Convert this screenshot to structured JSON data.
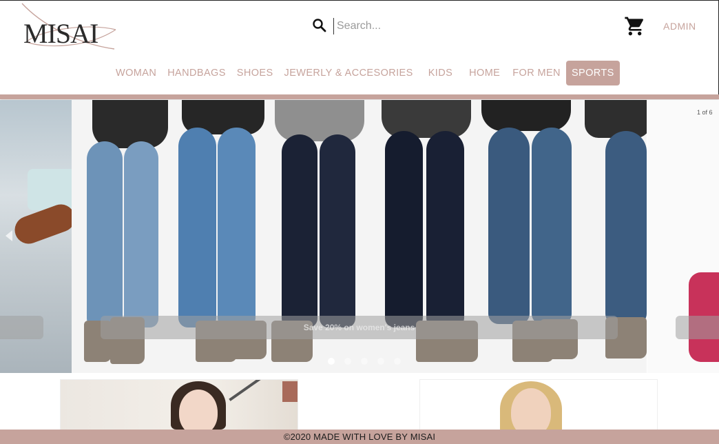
{
  "brand": {
    "logo_text": "MISAI"
  },
  "search": {
    "placeholder": "Search..."
  },
  "header": {
    "admin_label": "ADMIN"
  },
  "nav": {
    "items": [
      {
        "label": "WOMAN",
        "active": false
      },
      {
        "label": "HANDBAGS",
        "active": false
      },
      {
        "label": "SHOES",
        "active": false
      },
      {
        "label": "JEWERLY & ACCESORIES",
        "active": false
      },
      {
        "label": "KIDS",
        "active": false
      },
      {
        "label": "HOME",
        "active": false
      },
      {
        "label": "FOR MEN",
        "active": false
      },
      {
        "label": "SPORTS",
        "active": true
      }
    ]
  },
  "carousel": {
    "counter": "1 of 6",
    "caption": "Save 20% on women's jeans",
    "slide_count": 6,
    "active_slide": 1
  },
  "footer": {
    "text": "©2020 MADE WITH LOVE BY MISAI"
  },
  "colors": {
    "accent": "#c6a39c",
    "text_dark": "#1c1c1c"
  },
  "icons": [
    "search-icon",
    "cart-icon",
    "prev-arrow-icon"
  ]
}
